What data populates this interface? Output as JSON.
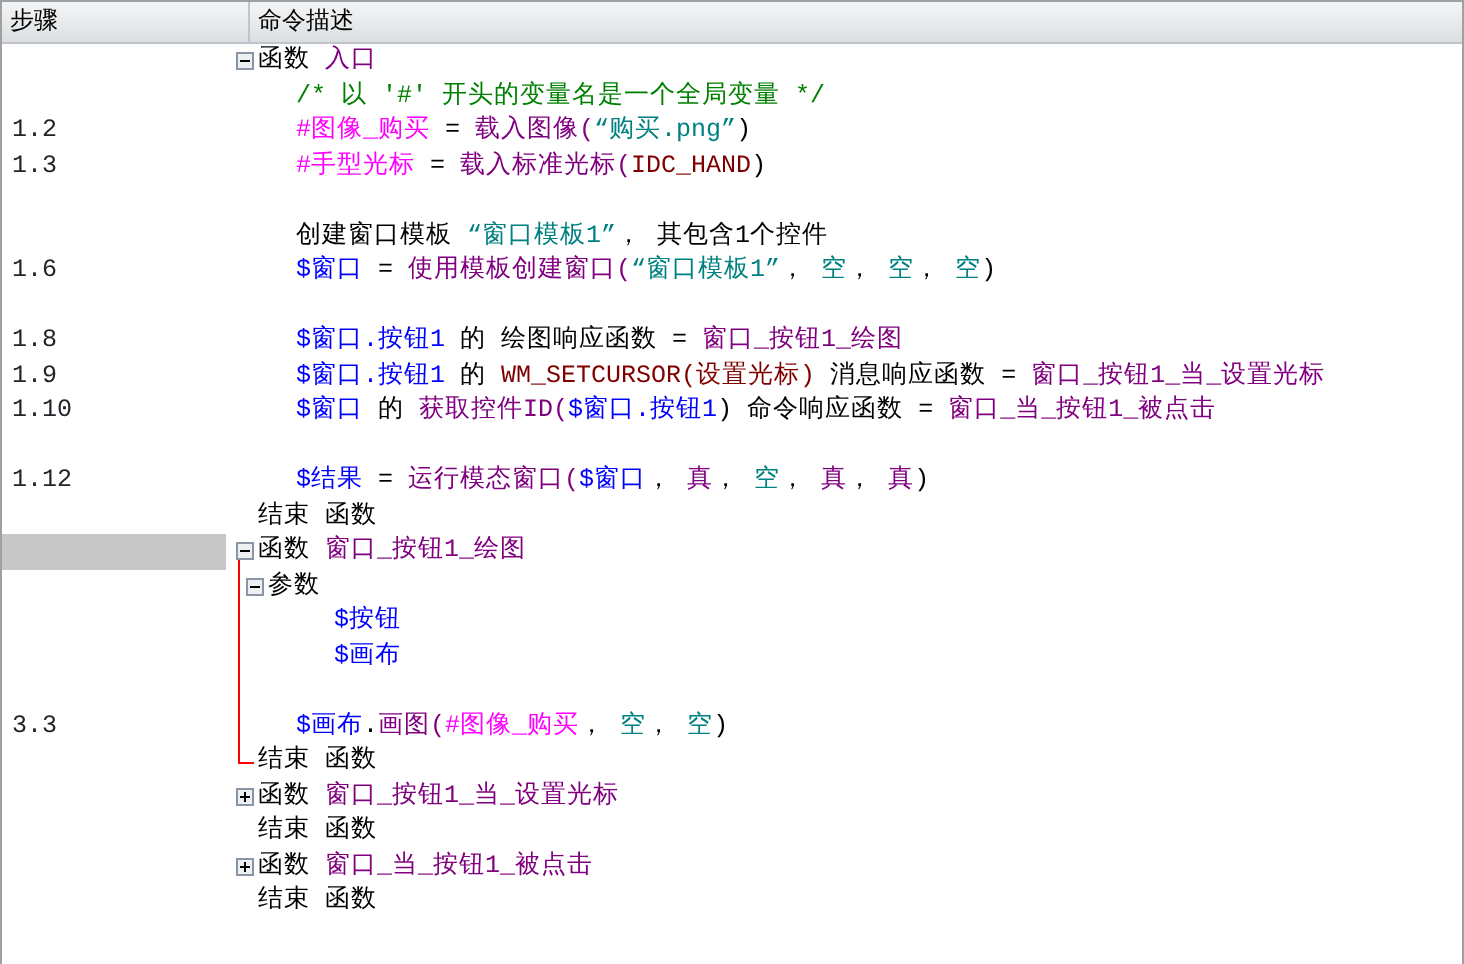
{
  "columns": [
    {
      "label": "步骤"
    },
    {
      "label": "命令描述"
    }
  ],
  "blocks": [
    {
      "expanded": true,
      "selected": false,
      "head": [
        {
          "kind": "keyword",
          "text": "函数 "
        },
        {
          "kind": "func",
          "text": "入口"
        }
      ],
      "lines": [
        {
          "kind": "line",
          "tokens": [
            {
              "kind": "comment",
              "text": "/* 以 '#' 开头的变量名是一个全局变量 */"
            }
          ]
        },
        {
          "kind": "line",
          "step": "1.2",
          "tokens": [
            {
              "kind": "global",
              "text": "#图像_购买"
            },
            {
              "kind": "plain",
              "text": " = "
            },
            {
              "kind": "func",
              "text": "载入图像("
            },
            {
              "kind": "string",
              "text": "“购买.png”"
            },
            {
              "kind": "plain",
              "text": ")"
            }
          ]
        },
        {
          "kind": "line",
          "step": "1.3",
          "tokens": [
            {
              "kind": "global",
              "text": "#手型光标"
            },
            {
              "kind": "plain",
              "text": " = "
            },
            {
              "kind": "func",
              "text": "载入标准光标("
            },
            {
              "kind": "constant",
              "text": "IDC_HAND"
            },
            {
              "kind": "plain",
              "text": ")"
            }
          ]
        },
        {
          "kind": "blank"
        },
        {
          "kind": "line",
          "tokens": [
            {
              "kind": "plain",
              "text": "创建窗口模板 "
            },
            {
              "kind": "string",
              "text": "“窗口模板1”"
            },
            {
              "kind": "plain",
              "text": "， 其包含1个控件"
            }
          ]
        },
        {
          "kind": "line",
          "step": "1.6",
          "tokens": [
            {
              "kind": "var",
              "text": "$窗口"
            },
            {
              "kind": "plain",
              "text": " = "
            },
            {
              "kind": "func",
              "text": "使用模板创建窗口("
            },
            {
              "kind": "string",
              "text": "“窗口模板1”"
            },
            {
              "kind": "plain",
              "text": "， "
            },
            {
              "kind": "string",
              "text": "空"
            },
            {
              "kind": "plain",
              "text": "， "
            },
            {
              "kind": "string",
              "text": "空"
            },
            {
              "kind": "plain",
              "text": "， "
            },
            {
              "kind": "string",
              "text": "空"
            },
            {
              "kind": "plain",
              "text": ")"
            }
          ]
        },
        {
          "kind": "blank"
        },
        {
          "kind": "line",
          "step": "1.8",
          "tokens": [
            {
              "kind": "var",
              "text": "$窗口.按钮1"
            },
            {
              "kind": "plain",
              "text": " 的 绘图响应函数 = "
            },
            {
              "kind": "func",
              "text": "窗口_按钮1_绘图"
            }
          ]
        },
        {
          "kind": "line",
          "step": "1.9",
          "tokens": [
            {
              "kind": "var",
              "text": "$窗口.按钮1"
            },
            {
              "kind": "plain",
              "text": " 的 "
            },
            {
              "kind": "constant",
              "text": "WM_SETCURSOR(设置光标)"
            },
            {
              "kind": "plain",
              "text": " 消息响应函数 = "
            },
            {
              "kind": "func",
              "text": "窗口_按钮1_当_设置光标"
            }
          ]
        },
        {
          "kind": "line",
          "step": "1.10",
          "tokens": [
            {
              "kind": "var",
              "text": "$窗口"
            },
            {
              "kind": "plain",
              "text": " 的 "
            },
            {
              "kind": "func",
              "text": "获取控件ID("
            },
            {
              "kind": "var",
              "text": "$窗口.按钮1"
            },
            {
              "kind": "plain",
              "text": ") 命令响应函数 = "
            },
            {
              "kind": "func",
              "text": "窗口_当_按钮1_被点击"
            }
          ]
        },
        {
          "kind": "blank"
        },
        {
          "kind": "line",
          "step": "1.12",
          "tokens": [
            {
              "kind": "var",
              "text": "$结果"
            },
            {
              "kind": "plain",
              "text": " = "
            },
            {
              "kind": "func",
              "text": "运行模态窗口("
            },
            {
              "kind": "var",
              "text": "$窗口"
            },
            {
              "kind": "plain",
              "text": "， "
            },
            {
              "kind": "func",
              "text": "真"
            },
            {
              "kind": "plain",
              "text": "， "
            },
            {
              "kind": "string",
              "text": "空"
            },
            {
              "kind": "plain",
              "text": "， "
            },
            {
              "kind": "func",
              "text": "真"
            },
            {
              "kind": "plain",
              "text": "， "
            },
            {
              "kind": "func",
              "text": "真"
            },
            {
              "kind": "plain",
              "text": ")"
            }
          ]
        }
      ],
      "end": [
        {
          "kind": "plain",
          "text": "结束 函数"
        }
      ]
    },
    {
      "expanded": true,
      "selected": true,
      "head": [
        {
          "kind": "keyword",
          "text": "函数 "
        },
        {
          "kind": "func",
          "text": "窗口_按钮1_绘图"
        }
      ],
      "lines": [
        {
          "kind": "group",
          "expanded": true,
          "tokens": [
            {
              "kind": "plain",
              "text": "参数"
            }
          ],
          "children": [
            {
              "kind": "line",
              "tokens": [
                {
                  "kind": "var",
                  "text": "$按钮"
                }
              ]
            },
            {
              "kind": "line",
              "tokens": [
                {
                  "kind": "var",
                  "text": "$画布"
                }
              ]
            }
          ]
        },
        {
          "kind": "blank"
        },
        {
          "kind": "line",
          "step": "3.3",
          "tokens": [
            {
              "kind": "var",
              "text": "$画布"
            },
            {
              "kind": "plain",
              "text": "."
            },
            {
              "kind": "func",
              "text": "画图("
            },
            {
              "kind": "global",
              "text": "#图像_购买"
            },
            {
              "kind": "plain",
              "text": "， "
            },
            {
              "kind": "string",
              "text": "空"
            },
            {
              "kind": "plain",
              "text": "， "
            },
            {
              "kind": "string",
              "text": "空"
            },
            {
              "kind": "plain",
              "text": ")"
            }
          ]
        }
      ],
      "end": [
        {
          "kind": "plain",
          "text": "结束 函数"
        }
      ]
    },
    {
      "expanded": false,
      "selected": false,
      "head": [
        {
          "kind": "keyword",
          "text": "函数 "
        },
        {
          "kind": "func",
          "text": "窗口_按钮1_当_设置光标"
        }
      ],
      "end": [
        {
          "kind": "plain",
          "text": "结束 函数"
        }
      ]
    },
    {
      "expanded": false,
      "selected": false,
      "head": [
        {
          "kind": "keyword",
          "text": "函数 "
        },
        {
          "kind": "func",
          "text": "窗口_当_按钮1_被点击"
        }
      ],
      "end": [
        {
          "kind": "plain",
          "text": "结束 函数"
        }
      ]
    }
  ]
}
